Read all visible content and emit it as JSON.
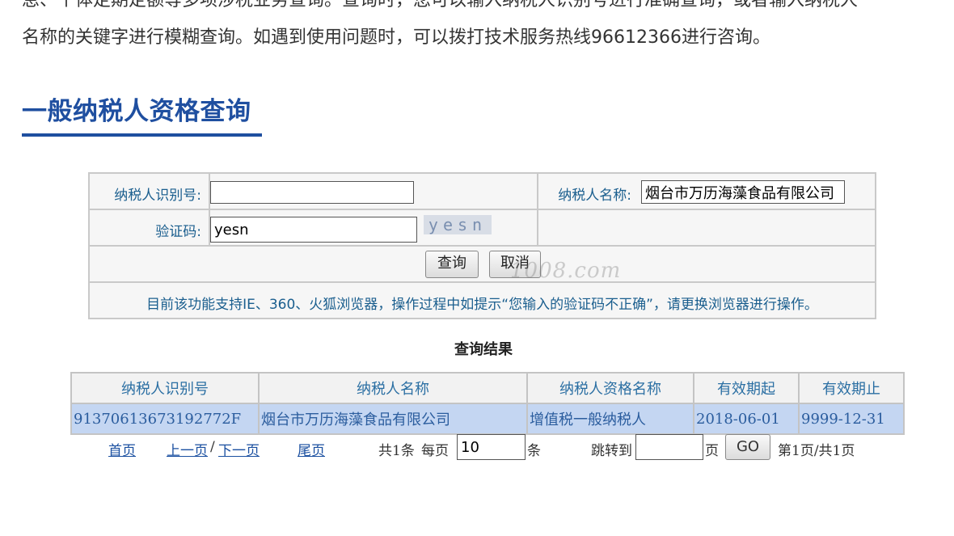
{
  "intro": {
    "line1": "息、个体定期定额等多项涉税业务查询。查询时，您可以输入纳税人识别号进行准确查询，或者输入纳税人",
    "line2": "名称的关键字进行模糊查询。如遇到使用问题时，可以拨打技术服务热线96612366进行咨询。"
  },
  "heading": "一般纳税人资格查询",
  "form": {
    "taxpayer_id_label": "纳税人识别号:",
    "taxpayer_id_value": "",
    "taxpayer_name_label": "纳税人名称:",
    "taxpayer_name_value": "烟台市万历海藻食品有限公司",
    "captcha_label": "验证码:",
    "captcha_value": "yesn",
    "captcha_image_text": "yesn",
    "query_button": "查询",
    "cancel_button": "取消",
    "watermark": "1008.com",
    "note": "目前该功能支持IE、360、火狐浏览器，操作过程中如提示“您输入的验证码不正确”，请更换浏览器进行操作。"
  },
  "results": {
    "title": "查询结果",
    "columns": [
      "纳税人识别号",
      "纳税人名称",
      "纳税人资格名称",
      "有效期起",
      "有效期止"
    ],
    "rows": [
      [
        "91370613673192772F",
        "烟台市万历海藻食品有限公司",
        "增值税一般纳税人",
        "2018-06-01",
        "9999-12-31"
      ]
    ]
  },
  "pager": {
    "first": "首页",
    "prev": "上一页",
    "sep": "/",
    "next": "下一页",
    "last": "尾页",
    "total": "共1条",
    "per_page_label": "每页",
    "per_page_value": "10",
    "per_page_unit": "条",
    "jump_label": "跳转到",
    "jump_value": "",
    "page_unit": "页",
    "go_button": "GO",
    "page_status": "第1页/共1页"
  },
  "colors": {
    "heading": "#1f4fa0",
    "label": "#1a5e8e",
    "row_highlight": "#c4d6f2"
  }
}
